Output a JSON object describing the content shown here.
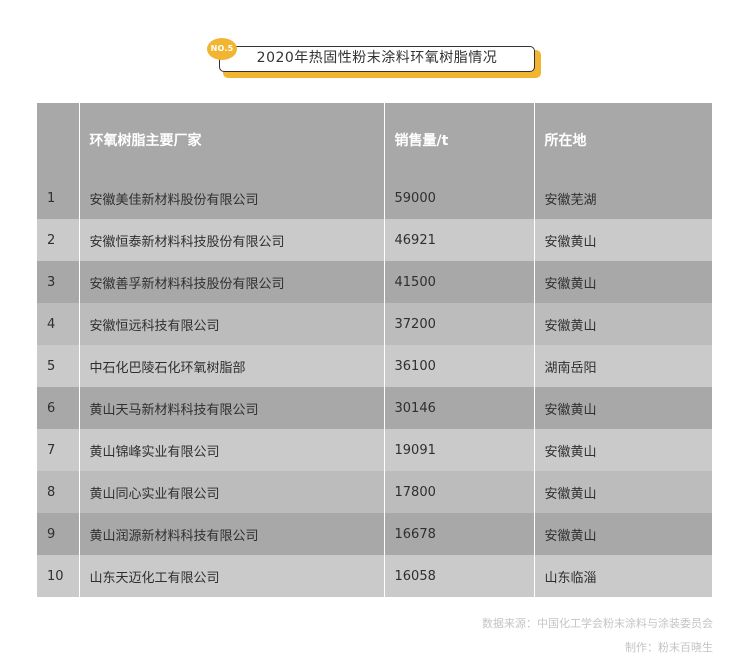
{
  "title": {
    "badge": "NO.5",
    "text": "2020年热固性粉末涂料环氧树脂情况"
  },
  "table": {
    "headers": [
      "",
      "环氧树脂主要厂家",
      "销售量/t",
      "所在地"
    ],
    "rows": [
      {
        "idx": "1",
        "name": "安徽美佳新材料股份有限公司",
        "sales": "59000",
        "location": "安徽芜湖"
      },
      {
        "idx": "2",
        "name": "安徽恒泰新材料科技股份有限公司",
        "sales": "46921",
        "location": "安徽黄山"
      },
      {
        "idx": "3",
        "name": "安徽善孚新材料科技股份有限公司",
        "sales": "41500",
        "location": "安徽黄山"
      },
      {
        "idx": "4",
        "name": "安徽恒远科技有限公司",
        "sales": "37200",
        "location": "安徽黄山"
      },
      {
        "idx": "5",
        "name": "中石化巴陵石化环氧树脂部",
        "sales": "36100",
        "location": "湖南岳阳"
      },
      {
        "idx": "6",
        "name": "黄山天马新材料科技有限公司",
        "sales": "30146",
        "location": "安徽黄山"
      },
      {
        "idx": "7",
        "name": "黄山锦峰实业有限公司",
        "sales": "19091",
        "location": "安徽黄山"
      },
      {
        "idx": "8",
        "name": "黄山同心实业有限公司",
        "sales": "17800",
        "location": "安徽黄山"
      },
      {
        "idx": "9",
        "name": "黄山润源新材料科技有限公司",
        "sales": "16678",
        "location": "安徽黄山"
      },
      {
        "idx": "10",
        "name": "山东天迈化工有限公司",
        "sales": "16058",
        "location": "山东临淄"
      }
    ]
  },
  "footer": {
    "source": "数据来源：中国化工学会粉末涂料与涂装委员会",
    "maker": "制作：粉末百晓生"
  },
  "colors": {
    "accent": "#f2b531",
    "header_bg": "#a8a8a8",
    "row_light": "#cacaca",
    "row_dark": "#a8a8a8"
  }
}
